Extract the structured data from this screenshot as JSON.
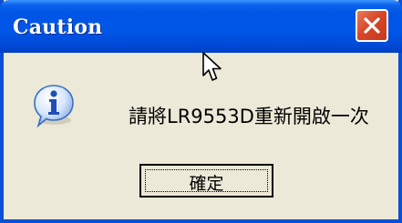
{
  "dialog": {
    "title": "Caution",
    "message": "請將LR9553D重新開啟一次",
    "ok_label": "確定"
  },
  "icons": {
    "close": "close-icon",
    "info": "information-icon",
    "cursor": "mouse-pointer"
  },
  "colors": {
    "titlebar": "#0055e5",
    "window_border": "#0a4fd6",
    "close_button": "#d9472a",
    "dialog_background": "#ece9d8"
  }
}
